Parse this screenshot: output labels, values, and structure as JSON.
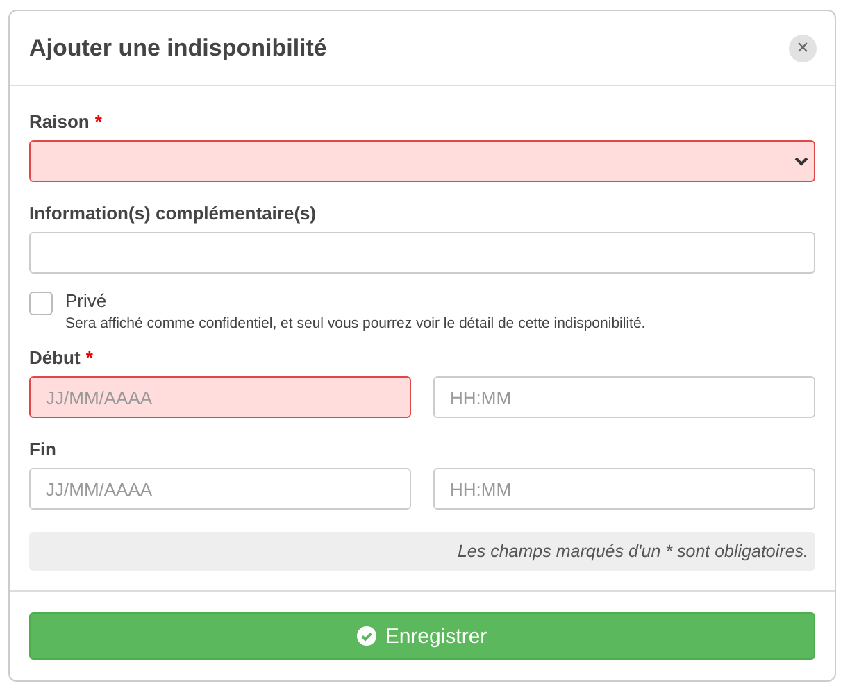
{
  "dialog": {
    "title": "Ajouter une indisponibilité",
    "close": "×"
  },
  "fields": [
    {
      "kind": "select",
      "label": "Raison",
      "mark": "*",
      "invalid": true
    },
    {
      "kind": "text",
      "label": "Information(s) complémentaire(s)",
      "invalid": false
    },
    {
      "kind": "checkbox",
      "label": "Privé",
      "help": "Sera affiché comme confidentiel, et seul vous pourrez voir le détail de cette indisponibilité.",
      "checked": false
    },
    {
      "kind": "datetime",
      "label": "Début",
      "mark": "*",
      "date": {
        "placeholder": "JJ/MM/AAAA",
        "invalid": true
      },
      "time": {
        "placeholder": "HH:MM",
        "invalid": false
      }
    },
    {
      "kind": "datetime",
      "label": "Fin",
      "date": {
        "placeholder": "JJ/MM/AAAA",
        "invalid": false
      },
      "time": {
        "placeholder": "HH:MM",
        "invalid": false
      }
    }
  ],
  "note": "Les champs marqués d'un * sont obligatoires.",
  "submit": {
    "label": "Enregistrer"
  }
}
